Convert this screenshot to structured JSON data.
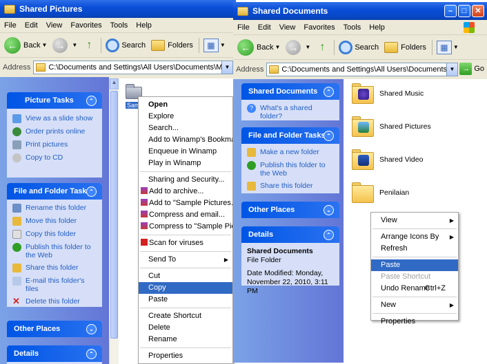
{
  "left_window": {
    "title": "Shared Pictures",
    "menu": [
      "File",
      "Edit",
      "View",
      "Favorites",
      "Tools",
      "Help"
    ],
    "toolbar": {
      "back": "Back",
      "search": "Search",
      "folders": "Folders"
    },
    "address_label": "Address",
    "address": "C:\\Documents and Settings\\All Users\\Documents\\My Pictures",
    "picture_tasks": {
      "title": "Picture Tasks",
      "items": [
        "View as a slide show",
        "Order prints online",
        "Print pictures",
        "Copy to CD"
      ]
    },
    "file_folder_tasks": {
      "title": "File and Folder Tasks",
      "items": [
        "Rename this folder",
        "Move this folder",
        "Copy this folder",
        "Publish this folder to the Web",
        "Share this folder",
        "E-mail this folder's files",
        "Delete this folder"
      ]
    },
    "other_places": {
      "title": "Other Places"
    },
    "details": {
      "title": "Details"
    },
    "selected_folder_label": "Sample Pictures"
  },
  "context_menu_left": {
    "items": [
      {
        "label": "Open",
        "bold": true
      },
      {
        "label": "Explore"
      },
      {
        "label": "Search..."
      },
      {
        "label": "Add to Winamp's Bookmark list"
      },
      {
        "label": "Enqueue in Winamp"
      },
      {
        "label": "Play in Winamp"
      },
      {
        "sep": true
      },
      {
        "label": "Sharing and Security..."
      },
      {
        "label": "Add to archive...",
        "icon": "winrar-icon"
      },
      {
        "label": "Add to \"Sample Pictures.rar\"",
        "icon": "winrar-icon"
      },
      {
        "label": "Compress and email...",
        "icon": "winrar-icon"
      },
      {
        "label": "Compress to \"Sample Pictures.rar\" and email",
        "icon": "winrar-icon"
      },
      {
        "sep": true
      },
      {
        "label": "Scan for viruses",
        "icon": "antivirus-icon"
      },
      {
        "sep": true
      },
      {
        "label": "Send To",
        "submenu": true
      },
      {
        "sep": true
      },
      {
        "label": "Cut"
      },
      {
        "label": "Copy",
        "highlight": true
      },
      {
        "label": "Paste"
      },
      {
        "sep": true
      },
      {
        "label": "Create Shortcut"
      },
      {
        "label": "Delete"
      },
      {
        "label": "Rename"
      },
      {
        "sep": true
      },
      {
        "label": "Properties"
      }
    ]
  },
  "right_window": {
    "title": "Shared Documents",
    "menu": [
      "File",
      "Edit",
      "View",
      "Favorites",
      "Tools",
      "Help"
    ],
    "toolbar": {
      "back": "Back",
      "search": "Search",
      "folders": "Folders"
    },
    "address_label": "Address",
    "address": "C:\\Documents and Settings\\All Users\\Documents",
    "go_label": "Go",
    "shared_documents_panel": {
      "title": "Shared Documents",
      "items": [
        "What's a shared folder?"
      ]
    },
    "file_folder_tasks": {
      "title": "File and Folder Tasks",
      "items": [
        "Make a new folder",
        "Publish this folder to the Web",
        "Share this folder"
      ]
    },
    "other_places": {
      "title": "Other Places"
    },
    "details": {
      "title": "Details",
      "name": "Shared Documents",
      "type": "File Folder",
      "modified": "Date Modified: Monday, November 22, 2010, 3:11 PM"
    },
    "folders": [
      "Shared Music",
      "Shared Pictures",
      "Shared Video",
      "Penilaian"
    ]
  },
  "context_menu_right": {
    "items": [
      {
        "label": "View",
        "submenu": true
      },
      {
        "sep": true
      },
      {
        "label": "Arrange Icons By",
        "submenu": true
      },
      {
        "label": "Refresh"
      },
      {
        "sep": true
      },
      {
        "label": "Paste",
        "highlight": true
      },
      {
        "label": "Paste Shortcut",
        "disabled": true
      },
      {
        "label": "Undo Rename",
        "shortcut": "Ctrl+Z"
      },
      {
        "sep": true
      },
      {
        "label": "New",
        "submenu": true
      },
      {
        "sep": true
      },
      {
        "label": "Properties"
      }
    ]
  }
}
